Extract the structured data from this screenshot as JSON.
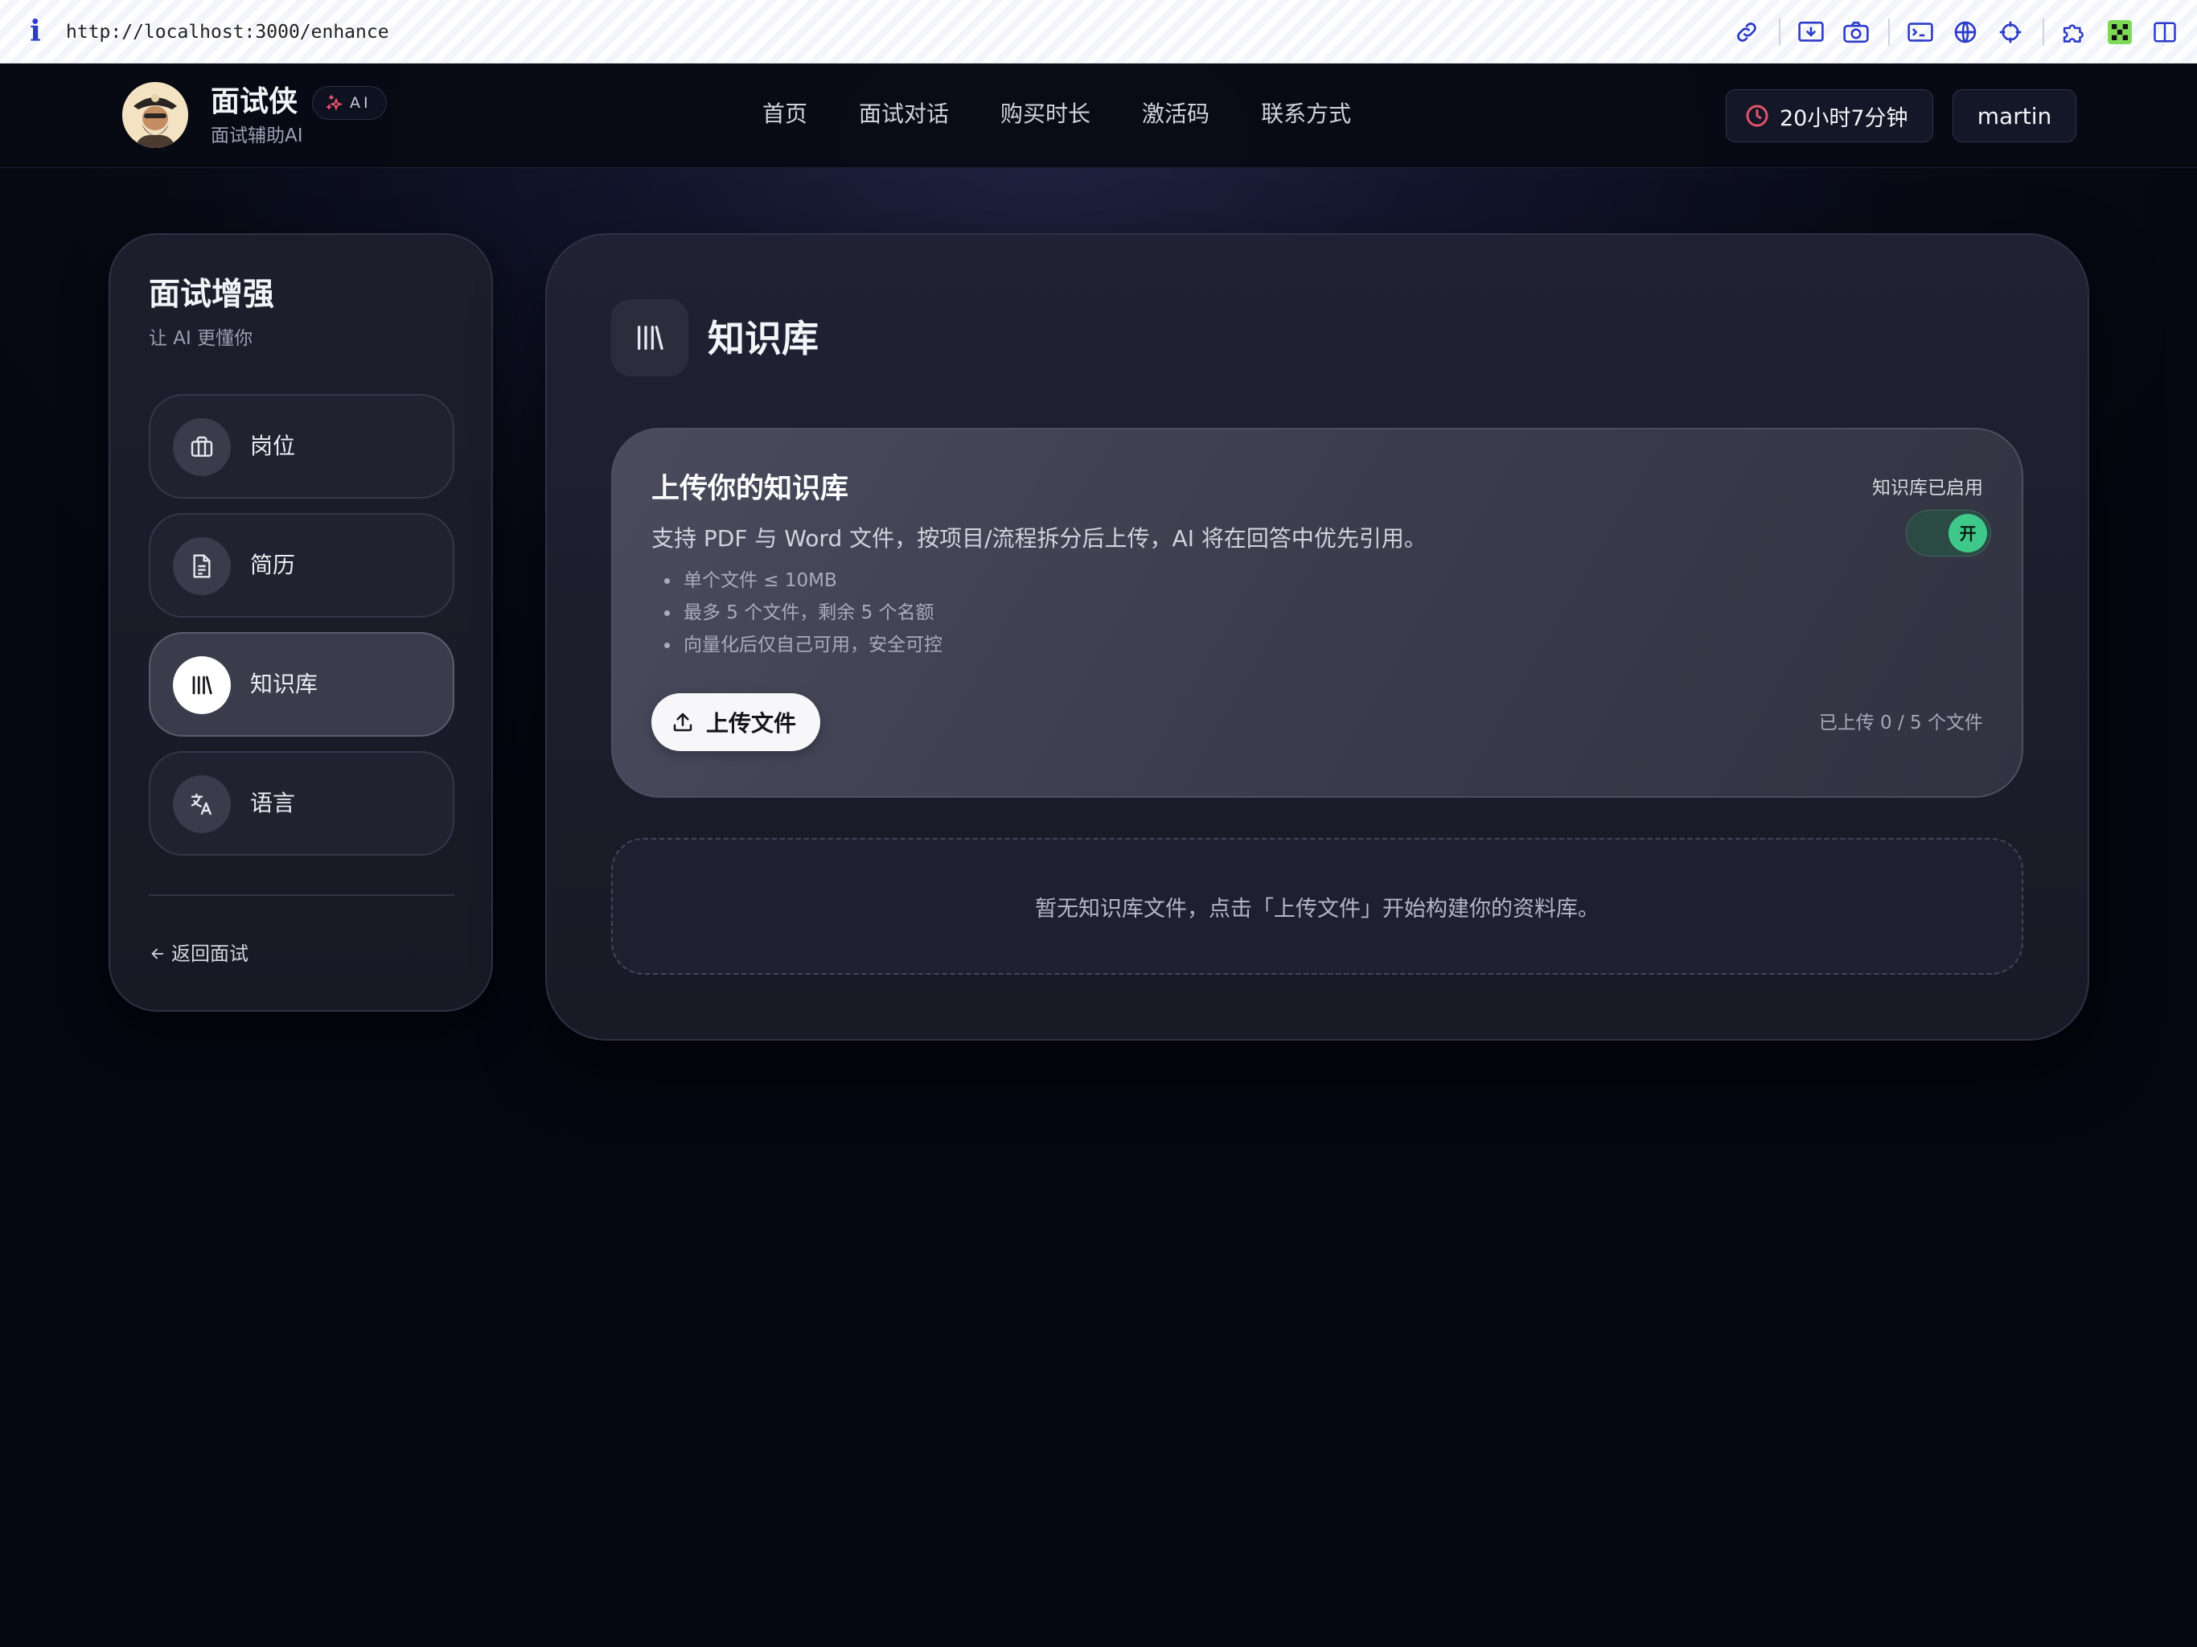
{
  "browser": {
    "url": "http://localhost:3000/enhance",
    "toolbar_icons": [
      "link-icon",
      "download-icon",
      "camera-icon",
      "terminal-icon",
      "globe-icon",
      "crosshair-icon",
      "puzzle-icon",
      "extension-icon",
      "sidebar-icon"
    ]
  },
  "header": {
    "brand_name": "面试侠",
    "ai_badge": "AI",
    "brand_sub": "面试辅助AI",
    "nav": [
      "首页",
      "面试对话",
      "购买时长",
      "激活码",
      "联系方式"
    ],
    "timer": "20小时7分钟",
    "user": "martin",
    "accent_color": "#e6536b"
  },
  "sidebar": {
    "title": "面试增强",
    "subtitle": "让 AI 更懂你",
    "items": [
      {
        "label": "岗位",
        "icon": "briefcase-icon",
        "active": false
      },
      {
        "label": "简历",
        "icon": "document-icon",
        "active": false
      },
      {
        "label": "知识库",
        "icon": "library-icon",
        "active": true
      },
      {
        "label": "语言",
        "icon": "translate-icon",
        "active": false
      }
    ],
    "back_label": "返回面试"
  },
  "main": {
    "title": "知识库",
    "upload_card": {
      "title": "上传你的知识库",
      "description": "支持 PDF 与 Word 文件，按项目/流程拆分后上传，AI 将在回答中优先引用。",
      "bullets": [
        "单个文件 ≤ 10MB",
        "最多 5 个文件，剩余 5 个名额",
        "向量化后仅自己可用，安全可控"
      ],
      "status_label": "知识库已启用",
      "toggle_label": "开",
      "toggle_on": true,
      "upload_button": "上传文件",
      "count_text": "已上传 0 / 5 个文件"
    },
    "empty_text": "暂无知识库文件，点击「上传文件」开始构建你的资料库。"
  }
}
